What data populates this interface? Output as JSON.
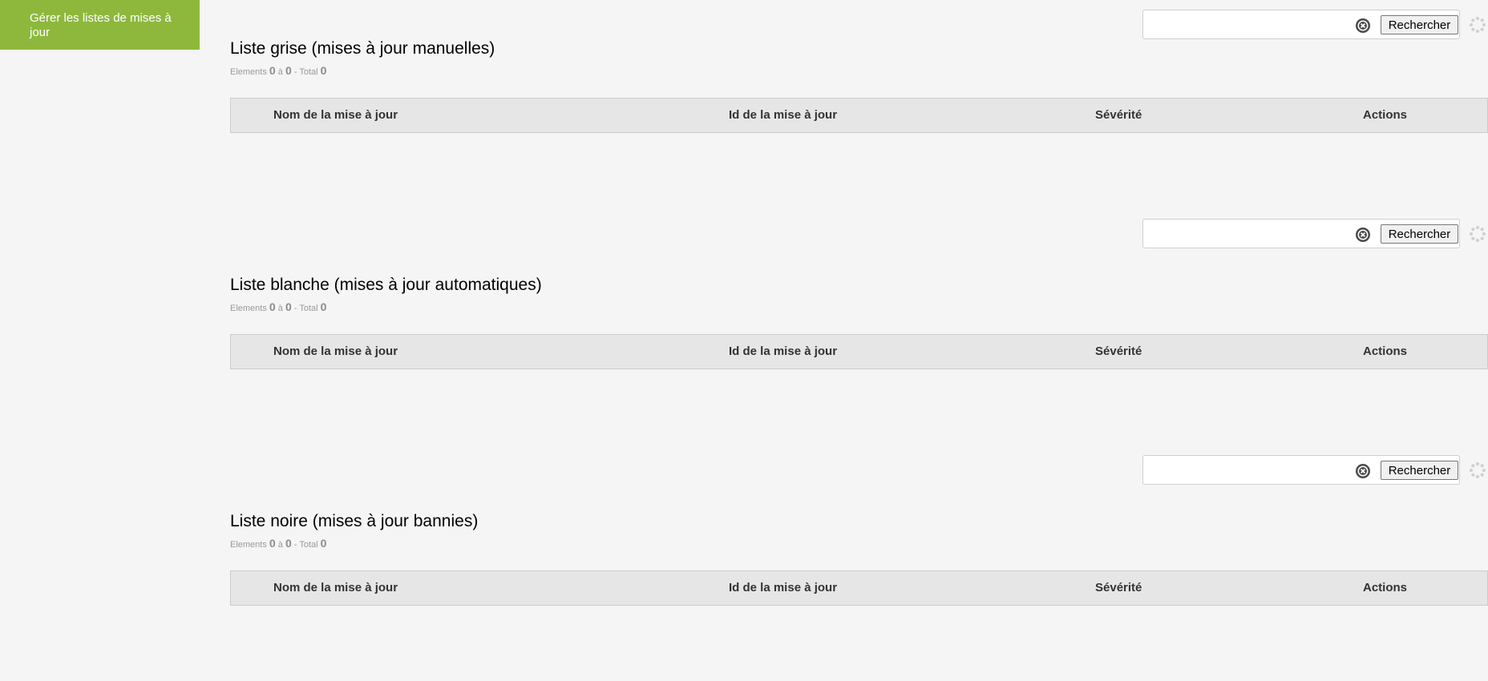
{
  "sidebar": {
    "manage_button_label": "Gérer les listes de mises à jour"
  },
  "search": {
    "button_label": "Rechercher",
    "placeholder": "",
    "value": ""
  },
  "columns": [
    "Nom de la mise à jour",
    "Id de la mise à jour",
    "Sévérité",
    "Actions"
  ],
  "counts_labels": {
    "elements": "Elements",
    "to": "à",
    "total": "- Total"
  },
  "lists": [
    {
      "title": "Liste grise (mises à jour manuelles)",
      "from": "0",
      "to": "0",
      "total": "0"
    },
    {
      "title": "Liste blanche (mises à jour automatiques)",
      "from": "0",
      "to": "0",
      "total": "0"
    },
    {
      "title": "Liste noire (mises à jour bannies)",
      "from": "0",
      "to": "0",
      "total": "0"
    }
  ],
  "colors": {
    "accent": "#8db83c",
    "background": "#f5f5f5",
    "header_bg": "#e6e6e6"
  },
  "icons": {
    "clear": "clear-search-icon",
    "spinner": "loading-spinner-icon"
  }
}
